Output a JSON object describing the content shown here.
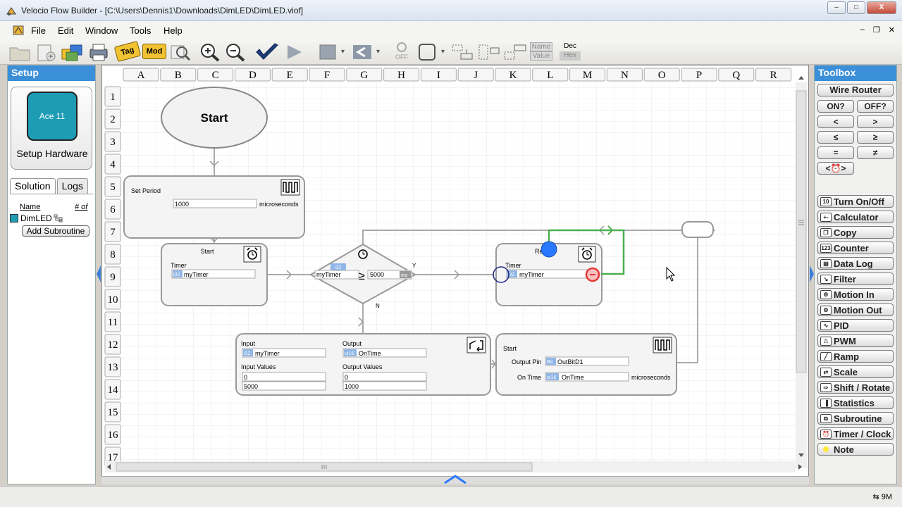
{
  "window": {
    "title": "Velocio Flow Builder - [C:\\Users\\Dennis1\\Downloads\\DimLED\\DimLED.viof]",
    "min": "–",
    "max": "□",
    "close": "X"
  },
  "menu": {
    "items": [
      "File",
      "Edit",
      "Window",
      "Tools",
      "Help"
    ],
    "mdi": [
      "–",
      "❐",
      "✕"
    ]
  },
  "toolbar": {
    "tag_label": "Tag",
    "mod_label": "Mod",
    "off_label": "OFF",
    "name_label": "Name",
    "value_label": "Value",
    "dec_label": "Dec",
    "hex_label": "Hex"
  },
  "setup": {
    "header": "Setup",
    "device": "Ace 11",
    "button": "Setup Hardware"
  },
  "solution": {
    "tabs": [
      "Solution",
      "Logs"
    ],
    "col_name": "Name",
    "col_count": "# of",
    "item": "DimLED",
    "add_button": "Add Subroutine"
  },
  "grid": {
    "columns": [
      "A",
      "B",
      "C",
      "D",
      "E",
      "F",
      "G",
      "H",
      "I",
      "J",
      "K",
      "L",
      "M",
      "N",
      "O",
      "P",
      "Q",
      "R"
    ],
    "rows": [
      "1",
      "2",
      "3",
      "4",
      "5",
      "6",
      "7",
      "8",
      "9",
      "10",
      "11",
      "12",
      "13",
      "14",
      "15",
      "16",
      "17"
    ]
  },
  "flow": {
    "start": "Start",
    "set_period": {
      "title": "Set Period",
      "value": "1000",
      "unit": "microseconds"
    },
    "timer_start": {
      "title": "Start",
      "label": "Timer",
      "type": "i32",
      "var": "myTimer"
    },
    "compare": {
      "type": "i32",
      "left": "myTimer",
      "op": "≥",
      "right": "5000",
      "unit": "ms",
      "yes": "Y",
      "no": "N"
    },
    "timer_reset": {
      "title": "Re",
      "label": "Timer",
      "type": "i32",
      "var": "myTimer"
    },
    "scale": {
      "input_label": "Input",
      "input_type": "i32",
      "input_var": "myTimer",
      "output_label": "Output",
      "output_type": "ui16",
      "output_var": "OnTime",
      "input_values_label": "Input Values",
      "in_vals": [
        "0",
        "5000"
      ],
      "output_values_label": "Output Values",
      "out_vals": [
        "0",
        "1000"
      ]
    },
    "pwm": {
      "title": "Start",
      "pin_label": "Output Pin",
      "pin_type": "Bit",
      "pin_var": "OutBitD1",
      "ontime_label": "On Time",
      "ontime_type": "ui16",
      "ontime_var": "OnTime",
      "unit": "microseconds"
    }
  },
  "toolbox": {
    "header": "Toolbox",
    "wire": "Wire Router",
    "compare_buttons": [
      "ON?",
      "OFF?",
      "<",
      ">",
      "≤",
      "≥",
      "=",
      "≠",
      "<⏰>"
    ],
    "tools": [
      {
        "label": "Turn On/Off",
        "icon": "10"
      },
      {
        "label": "Calculator",
        "icon": "+-"
      },
      {
        "label": "Copy",
        "icon": "❐"
      },
      {
        "label": "Counter",
        "icon": "123"
      },
      {
        "label": "Data Log",
        "icon": "▤"
      },
      {
        "label": "Filter",
        "icon": "↘"
      },
      {
        "label": "Motion In",
        "icon": "⚙"
      },
      {
        "label": "Motion Out",
        "icon": "⚙"
      },
      {
        "label": "PID",
        "icon": "∿"
      },
      {
        "label": "PWM",
        "icon": "⎍"
      },
      {
        "label": "Ramp",
        "icon": "╱"
      },
      {
        "label": "Scale",
        "icon": "⇄"
      },
      {
        "label": "Shift / Rotate",
        "icon": "⇨"
      },
      {
        "label": "Statistics",
        "icon": "▐"
      },
      {
        "label": "Subroutine",
        "icon": "⧉"
      },
      {
        "label": "Timer / Clock",
        "icon": "⏰"
      },
      {
        "label": "Note",
        "icon": ""
      }
    ]
  },
  "status": {
    "usb": "⇆ 9M"
  }
}
